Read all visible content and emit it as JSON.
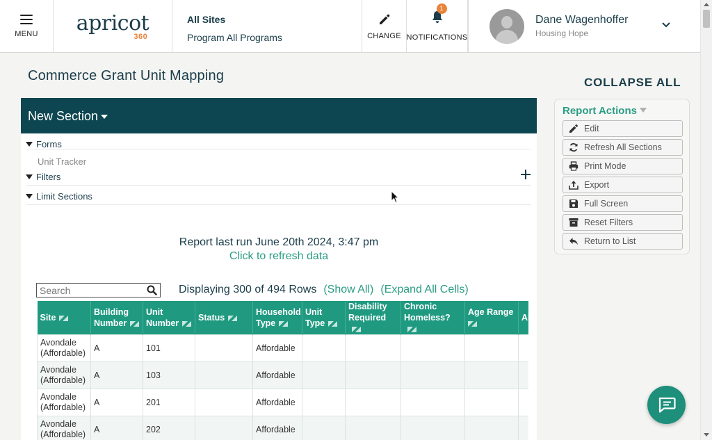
{
  "header": {
    "menu_label": "MENU",
    "logo_text": "apricot",
    "logo_sub": "360",
    "sites_title": "All Sites",
    "program_label": "Program All Programs",
    "change_label": "CHANGE",
    "notifications_label": "NOTIFICATIONS",
    "notifications_count": "1",
    "user_name": "Dane Wagenhoffer",
    "user_org": "Housing Hope"
  },
  "page": {
    "title": "Commerce Grant Unit Mapping",
    "collapse_all": "COLLAPSE ALL"
  },
  "section": {
    "title": "New Section",
    "forms_label": "Forms",
    "form_item": "Unit Tracker",
    "filters_label": "Filters",
    "limit_label": "Limit Sections",
    "report_run": "Report last run June 20th 2024, 3:47 pm",
    "refresh_link": "Click to refresh data",
    "search_placeholder": "Search",
    "display_count": "Displaying 300 of 494 Rows",
    "show_all": "(Show All)",
    "expand_all": "(Expand All Cells)"
  },
  "table": {
    "columns": [
      {
        "label": "Site"
      },
      {
        "label": "Building Number"
      },
      {
        "label": "Unit Number"
      },
      {
        "label": "Status"
      },
      {
        "label": "Household Type"
      },
      {
        "label": "Unit Type"
      },
      {
        "label": "Disability Required"
      },
      {
        "label": "Chronic Homeless?"
      },
      {
        "label": "Age Range"
      },
      {
        "label": "Al Li"
      }
    ],
    "rows": [
      [
        "Avondale (Affordable)",
        "A",
        "101",
        "",
        "Affordable",
        "",
        "",
        "",
        "",
        ""
      ],
      [
        "Avondale (Affordable)",
        "A",
        "103",
        "",
        "Affordable",
        "",
        "",
        "",
        "",
        ""
      ],
      [
        "Avondale (Affordable)",
        "A",
        "201",
        "",
        "Affordable",
        "",
        "",
        "",
        "",
        ""
      ],
      [
        "Avondale (Affordable)",
        "A",
        "202",
        "",
        "Affordable",
        "",
        "",
        "",
        "",
        ""
      ]
    ]
  },
  "actions": {
    "title": "Report Actions",
    "items": [
      {
        "label": "Edit",
        "icon": "pencil-icon"
      },
      {
        "label": "Refresh All Sections",
        "icon": "refresh-icon"
      },
      {
        "label": "Print Mode",
        "icon": "printer-icon"
      },
      {
        "label": "Export",
        "icon": "export-icon"
      },
      {
        "label": "Full Screen",
        "icon": "save-icon"
      },
      {
        "label": "Reset Filters",
        "icon": "archive-icon"
      },
      {
        "label": "Return to List",
        "icon": "reply-icon"
      }
    ]
  },
  "colors": {
    "navy": "#0d4650",
    "teal": "#1f9a80",
    "link": "#2a9d84",
    "orange": "#e8833a"
  }
}
